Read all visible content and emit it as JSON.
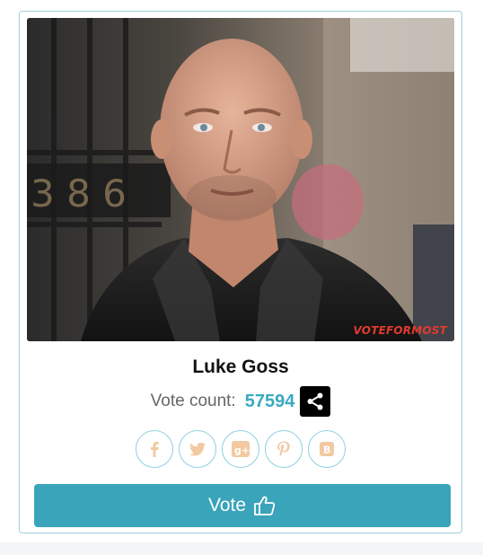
{
  "candidate": {
    "name": "Luke Goss",
    "photo_watermark": "VOTEFORMOST"
  },
  "votes": {
    "label": "Vote count:",
    "count": "57594"
  },
  "share": {
    "icon": "share-icon"
  },
  "social": [
    {
      "icon": "facebook-icon",
      "glyph": "f"
    },
    {
      "icon": "twitter-icon",
      "glyph": ""
    },
    {
      "icon": "google-plus-icon",
      "glyph": "g+"
    },
    {
      "icon": "pinterest-icon",
      "glyph": "P"
    },
    {
      "icon": "blogger-icon",
      "glyph": "B"
    }
  ],
  "vote_button": {
    "label": "Vote",
    "icon": "thumbs-up-icon"
  },
  "colors": {
    "accent": "#3aa4ba",
    "count": "#3aa8c1",
    "social_icon": "#f2c9a0",
    "card_border": "#9fd0dd",
    "watermark": "#e13a2e"
  }
}
